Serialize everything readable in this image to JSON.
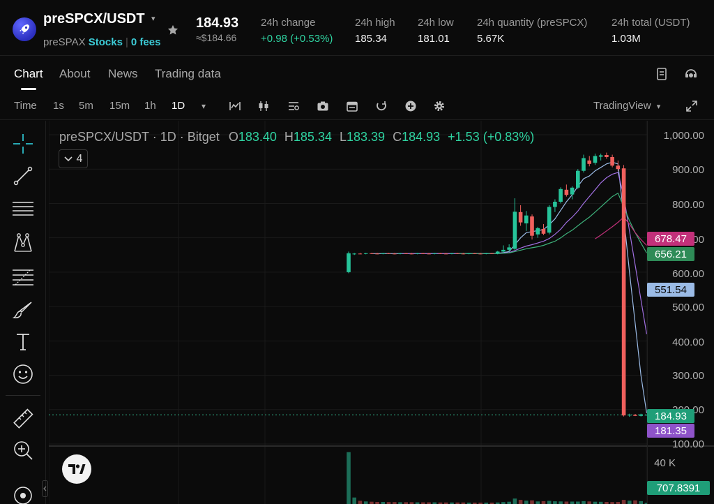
{
  "header": {
    "pair": "preSPCX/USDT",
    "sub_name": "preSPAX",
    "sub_tag": "Stocks",
    "sub_fees": "0 fees",
    "last_price": "184.93",
    "last_price_usd": "≈$184.66",
    "stats": [
      {
        "key": "24h change",
        "value": "+0.98 (+0.53%)",
        "up": true
      },
      {
        "key": "24h high",
        "value": "185.34"
      },
      {
        "key": "24h low",
        "value": "181.01"
      },
      {
        "key": "24h quantity (preSPCX)",
        "value": "5.67K"
      },
      {
        "key": "24h total (USDT)",
        "value": "1.03M"
      }
    ]
  },
  "tabs": [
    {
      "label": "Chart",
      "active": true
    },
    {
      "label": "About"
    },
    {
      "label": "News"
    },
    {
      "label": "Trading data"
    }
  ],
  "toolbar": {
    "intervals": [
      "Time",
      "1s",
      "5m",
      "15m",
      "1h",
      "1D"
    ],
    "active_interval": "1D",
    "caret": "▾",
    "provider": "TradingView",
    "icons": [
      "indicator-icon",
      "candle-type-icon",
      "settings-list-icon",
      "camera-icon",
      "calendar-icon",
      "replay-icon",
      "add-icon",
      "gear-icon",
      "fullscreen-icon"
    ]
  },
  "leftbar": {
    "icons": [
      "crosshair-icon",
      "trendline-icon",
      "horizontal-lines-icon",
      "pattern-icon",
      "fib-icon",
      "brush-icon",
      "text-icon",
      "emoji-icon",
      "ruler-icon",
      "zoom-in-icon",
      "magnet-icon"
    ]
  },
  "legend": {
    "symbol": "preSPCX/USDT",
    "interval": "1D",
    "exchange": "Bitget",
    "o_label": "O",
    "o": "183.40",
    "h_label": "H",
    "h": "185.34",
    "l_label": "L",
    "l": "183.39",
    "c_label": "C",
    "c": "184.93",
    "change": "+1.53 (+0.83%)",
    "indicators_count": "4"
  },
  "price_axis": {
    "ticks": [
      "1,000.00",
      "900.00",
      "800.00",
      "700.00",
      "600.00",
      "500.00",
      "400.00",
      "300.00",
      "200.00",
      "100.00"
    ],
    "vol_tick": "40 K"
  },
  "tags": [
    {
      "label": "678.47",
      "color": "#c2307a"
    },
    {
      "label": "656.21",
      "color": "#2e8b57"
    },
    {
      "label": "551.54",
      "color": "#9bbbe6"
    },
    {
      "label": "184.93",
      "color": "#1f9e78"
    },
    {
      "label": "181.35",
      "color": "#8e53c9"
    },
    {
      "label": "707.8391",
      "color": "#1f9e78"
    }
  ],
  "chart_data": {
    "type": "candlestick",
    "symbol": "preSPCX/USDT",
    "interval": "1D",
    "ylim": [
      100,
      1000
    ],
    "candles": [
      {
        "o": 600,
        "h": 660,
        "l": 597,
        "c": 655
      },
      {
        "o": 652,
        "h": 656,
        "l": 650,
        "c": 654
      },
      {
        "o": 654,
        "h": 656,
        "l": 652,
        "c": 653
      },
      {
        "o": 653,
        "h": 656,
        "l": 652,
        "c": 655
      },
      {
        "o": 655,
        "h": 656,
        "l": 653,
        "c": 654
      },
      {
        "o": 654,
        "h": 656,
        "l": 652,
        "c": 653
      },
      {
        "o": 653,
        "h": 656,
        "l": 652,
        "c": 655
      },
      {
        "o": 655,
        "h": 656,
        "l": 653,
        "c": 654
      },
      {
        "o": 654,
        "h": 656,
        "l": 652,
        "c": 653
      },
      {
        "o": 653,
        "h": 656,
        "l": 652,
        "c": 655
      },
      {
        "o": 655,
        "h": 656,
        "l": 653,
        "c": 654
      },
      {
        "o": 654,
        "h": 656,
        "l": 652,
        "c": 653
      },
      {
        "o": 653,
        "h": 656,
        "l": 652,
        "c": 655
      },
      {
        "o": 655,
        "h": 656,
        "l": 653,
        "c": 654
      },
      {
        "o": 654,
        "h": 656,
        "l": 652,
        "c": 653
      },
      {
        "o": 653,
        "h": 656,
        "l": 652,
        "c": 655
      },
      {
        "o": 655,
        "h": 656,
        "l": 653,
        "c": 654
      },
      {
        "o": 654,
        "h": 656,
        "l": 652,
        "c": 653
      },
      {
        "o": 653,
        "h": 656,
        "l": 652,
        "c": 655
      },
      {
        "o": 655,
        "h": 656,
        "l": 653,
        "c": 654
      },
      {
        "o": 654,
        "h": 656,
        "l": 652,
        "c": 653
      },
      {
        "o": 653,
        "h": 656,
        "l": 652,
        "c": 655
      },
      {
        "o": 655,
        "h": 656,
        "l": 653,
        "c": 654
      },
      {
        "o": 654,
        "h": 656,
        "l": 652,
        "c": 653
      },
      {
        "o": 653,
        "h": 656,
        "l": 652,
        "c": 655
      },
      {
        "o": 655,
        "h": 656,
        "l": 653,
        "c": 654
      },
      {
        "o": 654,
        "h": 662,
        "l": 652,
        "c": 660
      },
      {
        "o": 660,
        "h": 678,
        "l": 656,
        "c": 665
      },
      {
        "o": 665,
        "h": 681,
        "l": 660,
        "c": 672
      },
      {
        "o": 668,
        "h": 815,
        "l": 665,
        "c": 776
      },
      {
        "o": 775,
        "h": 795,
        "l": 735,
        "c": 745
      },
      {
        "o": 742,
        "h": 778,
        "l": 720,
        "c": 765
      },
      {
        "o": 762,
        "h": 768,
        "l": 695,
        "c": 706
      },
      {
        "o": 710,
        "h": 732,
        "l": 700,
        "c": 728
      },
      {
        "o": 726,
        "h": 740,
        "l": 708,
        "c": 712
      },
      {
        "o": 715,
        "h": 795,
        "l": 710,
        "c": 790
      },
      {
        "o": 790,
        "h": 812,
        "l": 775,
        "c": 805
      },
      {
        "o": 805,
        "h": 847,
        "l": 800,
        "c": 842
      },
      {
        "o": 840,
        "h": 855,
        "l": 820,
        "c": 825
      },
      {
        "o": 826,
        "h": 850,
        "l": 812,
        "c": 846
      },
      {
        "o": 846,
        "h": 900,
        "l": 842,
        "c": 895
      },
      {
        "o": 895,
        "h": 942,
        "l": 890,
        "c": 932
      },
      {
        "o": 925,
        "h": 938,
        "l": 908,
        "c": 915
      },
      {
        "o": 918,
        "h": 945,
        "l": 912,
        "c": 938
      },
      {
        "o": 936,
        "h": 945,
        "l": 925,
        "c": 940
      },
      {
        "o": 941,
        "h": 948,
        "l": 930,
        "c": 935
      },
      {
        "o": 935,
        "h": 942,
        "l": 905,
        "c": 910
      },
      {
        "o": 910,
        "h": 925,
        "l": 895,
        "c": 900
      },
      {
        "o": 902,
        "h": 912,
        "l": 180,
        "c": 183
      },
      {
        "o": 183,
        "h": 188,
        "l": 179,
        "c": 185
      },
      {
        "o": 185,
        "h": 187,
        "l": 181,
        "c": 182
      },
      {
        "o": 182,
        "h": 188,
        "l": 180,
        "c": 186
      },
      {
        "o": 183.4,
        "h": 185.34,
        "l": 183.39,
        "c": 184.93
      }
    ],
    "moving_averages": [
      {
        "color": "#9bbbe6",
        "values": [
          null,
          null,
          null,
          null,
          654,
          654,
          654,
          654,
          654,
          654,
          654,
          654,
          654,
          654,
          654,
          654,
          654,
          654,
          654,
          654,
          654,
          654,
          654,
          654,
          654,
          654,
          655,
          657,
          660,
          680,
          700,
          715,
          718,
          721,
          724,
          738,
          755,
          780,
          805,
          825,
          850,
          872,
          880,
          895,
          905,
          915,
          920,
          915,
          760,
          600,
          450,
          300,
          190
        ]
      },
      {
        "color": "#a06fe0",
        "values": [
          null,
          null,
          null,
          null,
          null,
          null,
          null,
          null,
          null,
          654,
          654,
          654,
          654,
          654,
          654,
          654,
          654,
          654,
          654,
          654,
          654,
          654,
          654,
          654,
          654,
          654,
          655,
          656,
          657,
          663,
          670,
          676,
          680,
          685,
          690,
          698,
          710,
          725,
          745,
          760,
          778,
          800,
          820,
          840,
          860,
          875,
          885,
          890,
          820,
          720,
          620,
          520,
          420
        ]
      },
      {
        "color": "#3db07a",
        "values": [
          null,
          null,
          null,
          null,
          null,
          null,
          null,
          null,
          null,
          null,
          null,
          null,
          null,
          null,
          null,
          null,
          null,
          null,
          null,
          654,
          654,
          654,
          654,
          654,
          654,
          654,
          654,
          655,
          656,
          660,
          664,
          668,
          671,
          674,
          678,
          684,
          690,
          700,
          712,
          722,
          735,
          748,
          760,
          775,
          790,
          805,
          820,
          830,
          790,
          750,
          715,
          685,
          656
        ]
      },
      {
        "color": "#c2307a",
        "values": [
          null,
          null,
          null,
          null,
          null,
          null,
          null,
          null,
          null,
          null,
          null,
          null,
          null,
          null,
          null,
          null,
          null,
          null,
          null,
          null,
          null,
          null,
          null,
          null,
          null,
          null,
          null,
          null,
          null,
          null,
          null,
          null,
          null,
          null,
          null,
          null,
          null,
          null,
          null,
          null,
          null,
          null,
          null,
          697,
          708,
          720,
          732,
          745,
          760,
          740,
          715,
          695,
          678
        ]
      }
    ],
    "volume": [
      40000,
      5000,
      2500,
      2000,
      1800,
      1600,
      1600,
      1500,
      1500,
      1400,
      1400,
      1400,
      1300,
      1300,
      1300,
      1300,
      1200,
      1200,
      1200,
      1200,
      1200,
      1100,
      1100,
      1100,
      1100,
      1100,
      1200,
      1500,
      1800,
      4200,
      3200,
      2600,
      2800,
      2000,
      2200,
      2400,
      2100,
      2000,
      1900,
      1900,
      1900,
      2200,
      2000,
      1800,
      1700,
      1600,
      1500,
      1600,
      3200,
      2600,
      2800,
      2200,
      707.8391
    ],
    "last_price": 184.93
  }
}
